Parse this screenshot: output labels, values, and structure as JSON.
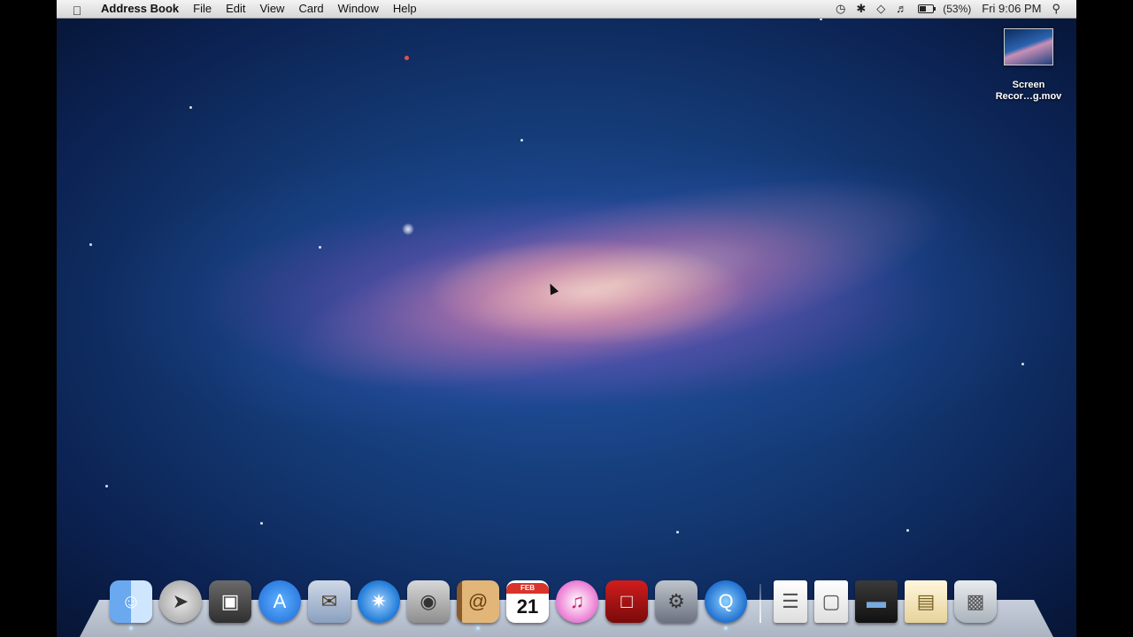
{
  "menubar": {
    "apple_icon": "apple-icon",
    "app_name": "Address Book",
    "menus": [
      "File",
      "Edit",
      "View",
      "Card",
      "Window",
      "Help"
    ],
    "status": {
      "time_machine_icon": "time-machine-icon",
      "bluetooth_icon": "bluetooth-icon",
      "wifi_icon": "wifi-icon",
      "volume_icon": "volume-icon",
      "battery_percent": "(53%)",
      "clock": "Fri 9:06 PM",
      "spotlight_icon": "spotlight-icon"
    }
  },
  "desktop": {
    "file_label": "Screen Recor…g.mov",
    "file_label_line1": "Screen",
    "file_label_line2": "Recor…g.mov"
  },
  "dock": {
    "items": [
      {
        "name": "Finder",
        "icon": "finder-icon"
      },
      {
        "name": "Launchpad",
        "icon": "launchpad-icon"
      },
      {
        "name": "Photo Browser",
        "icon": "photo-icon"
      },
      {
        "name": "App Store",
        "icon": "app-store-icon"
      },
      {
        "name": "Mail",
        "icon": "mail-icon"
      },
      {
        "name": "Safari",
        "icon": "safari-icon"
      },
      {
        "name": "FaceTime",
        "icon": "facetime-icon"
      },
      {
        "name": "Address Book",
        "icon": "address-book-icon"
      },
      {
        "name": "iCal",
        "icon": "ical-icon",
        "month": "FEB",
        "day": "21"
      },
      {
        "name": "iTunes",
        "icon": "itunes-icon"
      },
      {
        "name": "Photo Booth",
        "icon": "photo-booth-icon"
      },
      {
        "name": "System Preferences",
        "icon": "system-preferences-icon"
      },
      {
        "name": "QuickTime Player",
        "icon": "quicktime-icon"
      }
    ],
    "right_items": [
      {
        "name": "Document",
        "icon": "document-icon"
      },
      {
        "name": "Preview Document",
        "icon": "preview-icon"
      },
      {
        "name": "Device",
        "icon": "device-icon"
      },
      {
        "name": "Documents Folder",
        "icon": "folder-icon"
      },
      {
        "name": "Trash",
        "icon": "trash-icon"
      }
    ]
  }
}
